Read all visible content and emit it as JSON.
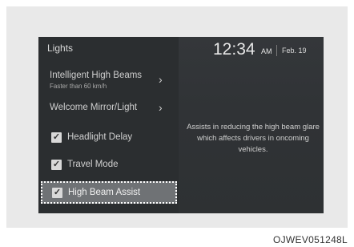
{
  "screen": {
    "title": "Lights",
    "clock": {
      "time": "12:34",
      "ampm": "AM",
      "date": "Feb. 19"
    },
    "menu_items": [
      {
        "label": "Intelligent High Beams",
        "sublabel": "Faster than 60 km/h",
        "chevron": "›"
      },
      {
        "label": "Welcome Mirror/Light",
        "chevron": "›"
      }
    ],
    "checkbox_items": [
      {
        "label": "Headlight Delay",
        "checked": true,
        "check_glyph": "✓"
      },
      {
        "label": "Travel Mode",
        "checked": true,
        "check_glyph": "✓"
      },
      {
        "label": "High Beam Assist",
        "checked": true,
        "check_glyph": "✓",
        "selected": true
      }
    ],
    "description": "Assists in reducing the high beam glare which affects drivers in oncoming vehicles."
  },
  "figure_code": "OJWEV051248L",
  "colors": {
    "screen_bg": "#2f3234",
    "selected_bg": "#6f7275",
    "text": "#cfcfcf"
  }
}
